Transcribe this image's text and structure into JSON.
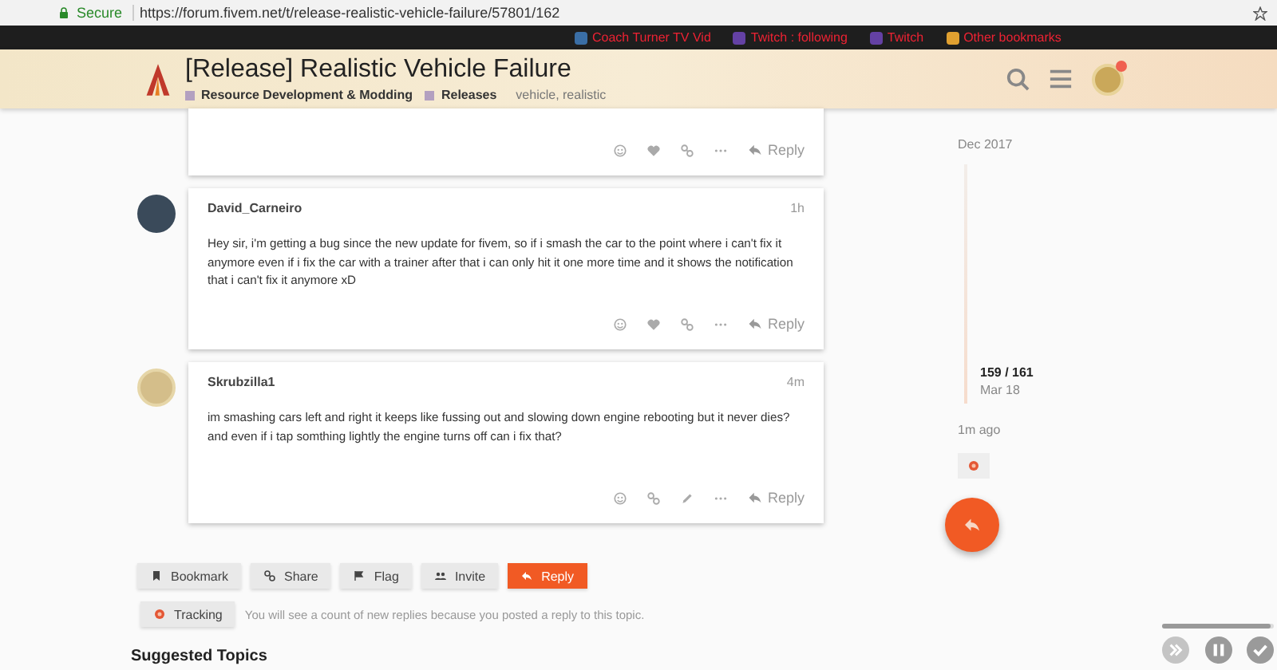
{
  "browser": {
    "secure_label": "Secure",
    "url": "https://forum.fivem.net/t/release-realistic-vehicle-failure/57801/162",
    "bookmarks": [
      {
        "label": "Coach Turner TV Vid",
        "color": "#3a6ea5"
      },
      {
        "label": "Twitch : following",
        "color": "#6441a4"
      },
      {
        "label": "Twitch",
        "color": "#6441a4"
      },
      {
        "label": "Other bookmarks",
        "color": "#e0a030"
      }
    ]
  },
  "header": {
    "title": "[Release] Realistic Vehicle Failure",
    "categories": [
      {
        "name": "Resource Development & Modding",
        "color": "#b3a0c0"
      },
      {
        "name": "Releases",
        "color": "#b3a0c0"
      }
    ],
    "tags": "vehicle, realistic"
  },
  "posts": [
    {
      "actions": [
        {
          "kind": "emoji"
        },
        {
          "kind": "heart"
        },
        {
          "kind": "link"
        },
        {
          "kind": "more"
        }
      ],
      "reply": "Reply"
    },
    {
      "author": "David_Carneiro",
      "time": "1h",
      "body": "Hey sir, i'm getting a bug since the new update for fivem, so if i smash the car to the point where i can't fix it anymore even if i fix the car with a trainer after that i can only hit it one more time and it shows the notification that i can't fix it anymore xD",
      "actions": [
        {
          "kind": "emoji"
        },
        {
          "kind": "heart"
        },
        {
          "kind": "link"
        },
        {
          "kind": "more"
        }
      ],
      "reply": "Reply"
    },
    {
      "author": "Skrubzilla1",
      "time": "4m",
      "body": "im smashing cars left and right it keeps like fussing out and slowing down engine rebooting but it never dies? and even if i tap somthing lightly the engine turns off can i fix that?",
      "actions": [
        {
          "kind": "emoji"
        },
        {
          "kind": "link"
        },
        {
          "kind": "edit"
        },
        {
          "kind": "more"
        }
      ],
      "reply": "Reply"
    }
  ],
  "footer_buttons": [
    {
      "label": "Bookmark",
      "kind": "bookmark",
      "primary": false
    },
    {
      "label": "Share",
      "kind": "link",
      "primary": false
    },
    {
      "label": "Flag",
      "kind": "flag",
      "primary": false
    },
    {
      "label": "Invite",
      "kind": "users",
      "primary": false
    },
    {
      "label": "Reply",
      "kind": "reply",
      "primary": true
    }
  ],
  "tracking": {
    "label": "Tracking",
    "note": "You will see a count of new replies because you posted a reply to this topic."
  },
  "suggested_heading": "Suggested Topics",
  "timeline": {
    "start": "Dec 2017",
    "position": "159 / 161",
    "date": "Mar 18",
    "last_activity": "1m ago"
  },
  "video_progress": {
    "level": 0.97
  }
}
